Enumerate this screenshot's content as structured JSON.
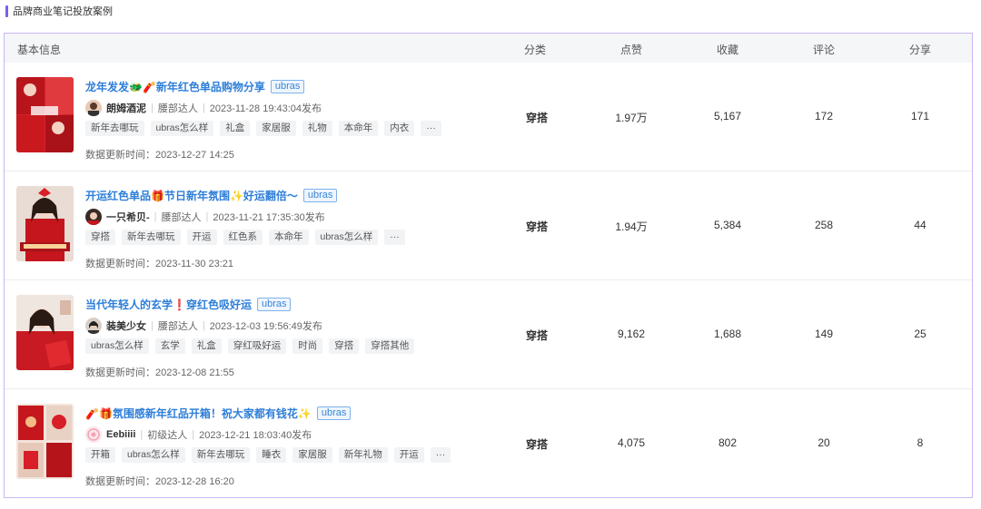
{
  "section_title": "品牌商业笔记投放案例",
  "table": {
    "headers": {
      "basic": "基本信息",
      "category": "分类",
      "likes": "点赞",
      "collects": "收藏",
      "comments": "评论",
      "shares": "分享"
    },
    "rows": [
      {
        "title": "龙年发发🐲🧨新年红色单品购物分享",
        "brand": "ubras",
        "author": "朗姆酒泥",
        "level": "腰部达人",
        "published": "2023-11-28 19:43:04发布",
        "tags": [
          "新年去哪玩",
          "ubras怎么样",
          "礼盒",
          "家居服",
          "礼物",
          "本命年",
          "内衣",
          "···"
        ],
        "update_time": "数据更新时间：2023-12-27 14:25",
        "category": "穿搭",
        "likes": "1.97万",
        "collects": "5,167",
        "comments": "172",
        "shares": "171"
      },
      {
        "title": "开运红色单品🎁节日新年氛围✨好运翻倍～",
        "brand": "ubras",
        "author": "一只希贝-",
        "level": "腰部达人",
        "published": "2023-11-21 17:35:30发布",
        "tags": [
          "穿搭",
          "新年去哪玩",
          "开运",
          "红色系",
          "本命年",
          "ubras怎么样",
          "···"
        ],
        "update_time": "数据更新时间：2023-11-30 23:21",
        "category": "穿搭",
        "likes": "1.94万",
        "collects": "5,384",
        "comments": "258",
        "shares": "44"
      },
      {
        "title": "当代年轻人的玄学❗穿红色吸好运",
        "brand": "ubras",
        "author": "装美少女",
        "level": "腰部达人",
        "published": "2023-12-03 19:56:49发布",
        "tags": [
          "ubras怎么样",
          "玄学",
          "礼盒",
          "穿红吸好运",
          "时尚",
          "穿搭",
          "穿搭其他"
        ],
        "update_time": "数据更新时间：2023-12-08 21:55",
        "category": "穿搭",
        "likes": "9,162",
        "collects": "1,688",
        "comments": "149",
        "shares": "25"
      },
      {
        "title": "🧨🎁氛围感新年红品开箱！祝大家都有钱花✨",
        "brand": "ubras",
        "author": "Eebiiii",
        "level": "初级达人",
        "published": "2023-12-21 18:03:40发布",
        "tags": [
          "开箱",
          "ubras怎么样",
          "新年去哪玩",
          "睡衣",
          "家居服",
          "新年礼物",
          "开运",
          "···"
        ],
        "update_time": "数据更新时间：2023-12-28 16:20",
        "category": "穿搭",
        "likes": "4,075",
        "collects": "802",
        "comments": "20",
        "shares": "8"
      }
    ]
  },
  "colors": {
    "accent": "#7b5fe8",
    "title_link": "#2e7ed8",
    "border": "#c8b6f5",
    "thumb_red": "#c4161c"
  }
}
